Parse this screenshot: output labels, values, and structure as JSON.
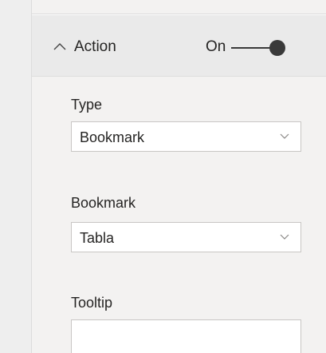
{
  "action_section": {
    "title": "Action",
    "toggle_label": "On",
    "toggle_state": "on"
  },
  "fields": {
    "type": {
      "label": "Type",
      "value": "Bookmark"
    },
    "bookmark": {
      "label": "Bookmark",
      "value": "Tabla"
    },
    "tooltip": {
      "label": "Tooltip",
      "value": ""
    }
  },
  "icons": {
    "collapse": "chevron-up-icon",
    "dropdown": "chevron-down-icon"
  },
  "colors": {
    "panel_background": "#f3f2f1",
    "header_background": "#eaeaea",
    "toggle_color": "#3a3a3a",
    "text": "#252423",
    "input_border": "#c8c6c4"
  }
}
